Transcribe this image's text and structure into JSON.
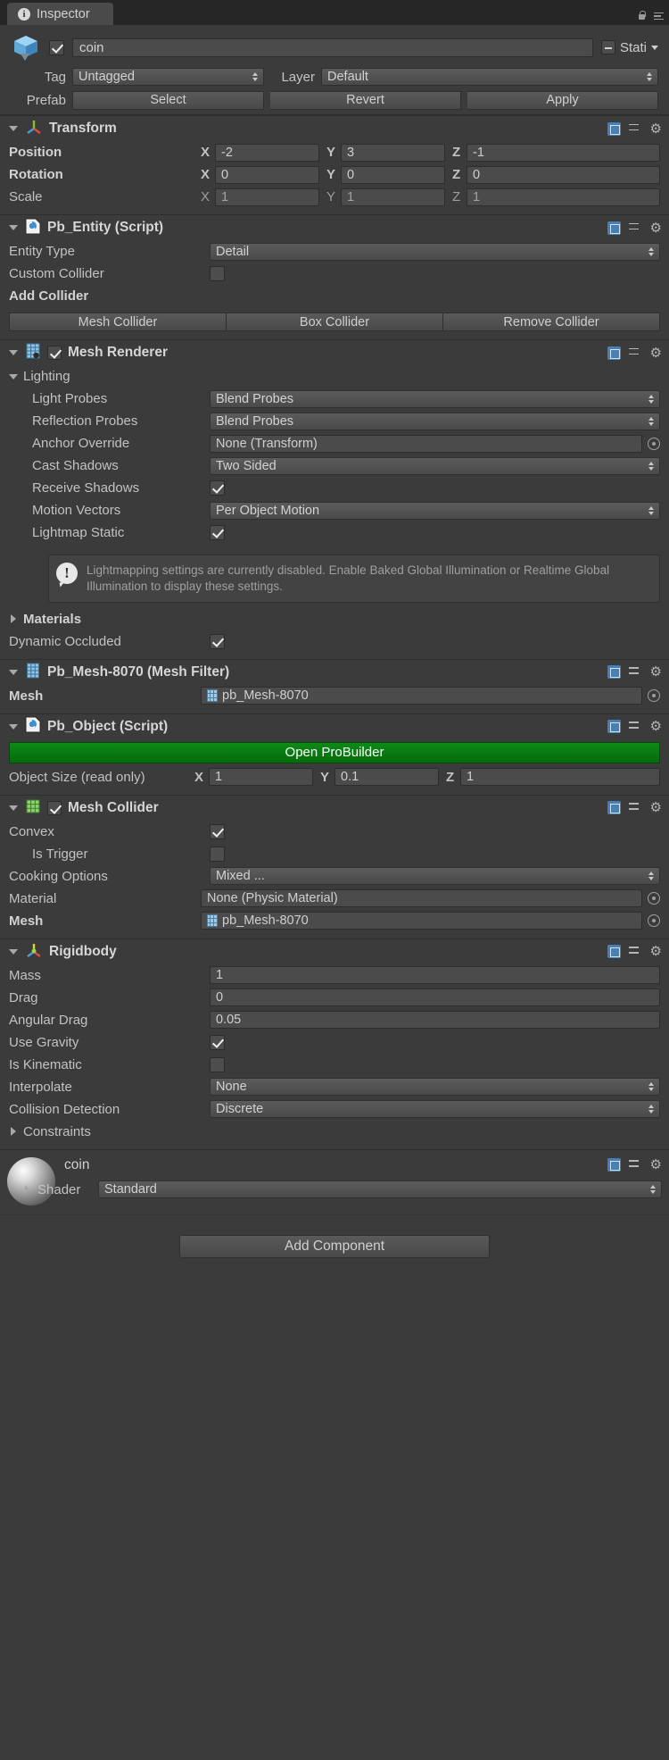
{
  "window": {
    "tab_label": "Inspector",
    "tab_icon": "info-circle-icon",
    "lock_icon": "lock-icon",
    "menu_icon": "hamburger-menu-icon"
  },
  "object_header": {
    "icon": "cube-icon",
    "enabled_checkbox": true,
    "name": "coin",
    "static_label": "Stati",
    "tag_label": "Tag",
    "tag_value": "Untagged",
    "layer_label": "Layer",
    "layer_value": "Default",
    "prefab_label": "Prefab",
    "prefab_select": "Select",
    "prefab_revert": "Revert",
    "prefab_apply": "Apply"
  },
  "components": [
    {
      "id": "transform",
      "title": "Transform",
      "icon": "transform-axis-icon",
      "rows": [
        {
          "label": "Position",
          "bold": true,
          "x": "-2",
          "y": "3",
          "z": "-1"
        },
        {
          "label": "Rotation",
          "bold": true,
          "x": "0",
          "y": "0",
          "z": "0"
        },
        {
          "label": "Scale",
          "bold": false,
          "x": "1",
          "y": "1",
          "z": "1"
        }
      ]
    },
    {
      "id": "pb_entity",
      "title": "Pb_Entity (Script)",
      "icon": "script-icon",
      "entity_type_label": "Entity Type",
      "entity_type_value": "Detail",
      "custom_collider_label": "Custom Collider",
      "custom_collider_checked": false,
      "add_collider_label": "Add Collider",
      "buttons": [
        "Mesh Collider",
        "Box Collider",
        "Remove Collider"
      ]
    },
    {
      "id": "mesh_renderer",
      "title": "Mesh Renderer",
      "icon": "mesh-renderer-icon",
      "enabled": true,
      "lighting_label": "Lighting",
      "lighting_rows": [
        {
          "label": "Light Probes",
          "type": "popup",
          "value": "Blend Probes"
        },
        {
          "label": "Reflection Probes",
          "type": "popup",
          "value": "Blend Probes"
        },
        {
          "label": "Anchor Override",
          "type": "object",
          "value": "None (Transform)"
        },
        {
          "label": "Cast Shadows",
          "type": "popup",
          "value": "Two Sided"
        },
        {
          "label": "Receive Shadows",
          "type": "check",
          "value": true
        },
        {
          "label": "Motion Vectors",
          "type": "popup",
          "value": "Per Object Motion"
        },
        {
          "label": "Lightmap Static",
          "type": "check",
          "value": true
        }
      ],
      "info_text": "Lightmapping settings are currently disabled. Enable Baked Global Illumination or Realtime Global Illumination to display these settings.",
      "materials_label": "Materials",
      "dynamic_occluded_label": "Dynamic Occluded",
      "dynamic_occluded_checked": true
    },
    {
      "id": "mesh_filter",
      "title": "Pb_Mesh-8070 (Mesh Filter)",
      "icon": "mesh-filter-icon",
      "mesh_label": "Mesh",
      "mesh_value": "pb_Mesh-8070"
    },
    {
      "id": "pb_object",
      "title": "Pb_Object (Script)",
      "icon": "script-icon",
      "open_probuilder_label": "Open ProBuilder",
      "open_probuilder_color": "#0a7c12",
      "object_size_label": "Object Size (read only)",
      "size_x": "1",
      "size_y": "0.1",
      "size_z": "1"
    },
    {
      "id": "mesh_collider",
      "title": "Mesh Collider",
      "icon": "mesh-collider-icon",
      "enabled": true,
      "rows": [
        {
          "label": "Convex",
          "type": "check",
          "value": true,
          "indent": 0
        },
        {
          "label": "Is Trigger",
          "type": "check",
          "value": false,
          "indent": 1
        },
        {
          "label": "Cooking Options",
          "type": "popup",
          "value": "Mixed ...",
          "indent": 0
        },
        {
          "label": "Material",
          "type": "object",
          "value": "None (Physic Material)",
          "indent": 0
        },
        {
          "label": "Mesh",
          "type": "mesh",
          "value": "pb_Mesh-8070",
          "indent": 0,
          "bold": true
        }
      ]
    },
    {
      "id": "rigidbody",
      "title": "Rigidbody",
      "icon": "rigidbody-icon",
      "rows": [
        {
          "label": "Mass",
          "type": "text",
          "value": "1"
        },
        {
          "label": "Drag",
          "type": "text",
          "value": "0"
        },
        {
          "label": "Angular Drag",
          "type": "text",
          "value": "0.05"
        },
        {
          "label": "Use Gravity",
          "type": "check",
          "value": true
        },
        {
          "label": "Is Kinematic",
          "type": "check",
          "value": false
        },
        {
          "label": "Interpolate",
          "type": "popup",
          "value": "None"
        },
        {
          "label": "Collision Detection",
          "type": "popup",
          "value": "Discrete"
        }
      ],
      "constraints_label": "Constraints"
    }
  ],
  "material_preview": {
    "name": "coin",
    "shader_label": "Shader",
    "shader_value": "Standard",
    "sphere_icon": "material-sphere-icon"
  },
  "footer": {
    "add_component_label": "Add Component"
  }
}
